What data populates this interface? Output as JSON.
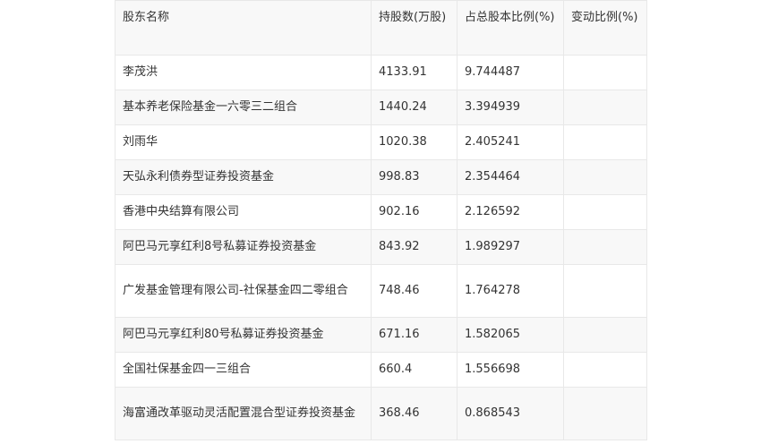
{
  "table": {
    "headers": [
      "股东名称",
      "持股数(万股)",
      "占总股本比例(%)",
      "变动比例(%)"
    ],
    "rows": [
      [
        "李茂洪",
        "4133.91",
        "9.744487",
        ""
      ],
      [
        "基本养老保险基金一六零三二组合",
        "1440.24",
        "3.394939",
        ""
      ],
      [
        "刘雨华",
        "1020.38",
        "2.405241",
        ""
      ],
      [
        "天弘永利债券型证券投资基金",
        "998.83",
        "2.354464",
        ""
      ],
      [
        "香港中央结算有限公司",
        "902.16",
        "2.126592",
        ""
      ],
      [
        "阿巴马元享红利8号私募证券投资基金",
        "843.92",
        "1.989297",
        ""
      ],
      [
        "广发基金管理有限公司-社保基金四二零组合",
        "748.46",
        "1.764278",
        ""
      ],
      [
        "阿巴马元享红利80号私募证券投资基金",
        "671.16",
        "1.582065",
        ""
      ],
      [
        "全国社保基金四一三组合",
        "660.4",
        "1.556698",
        ""
      ],
      [
        "海富通改革驱动灵活配置混合型证券投资基金",
        "368.46",
        "0.868543",
        ""
      ]
    ]
  }
}
